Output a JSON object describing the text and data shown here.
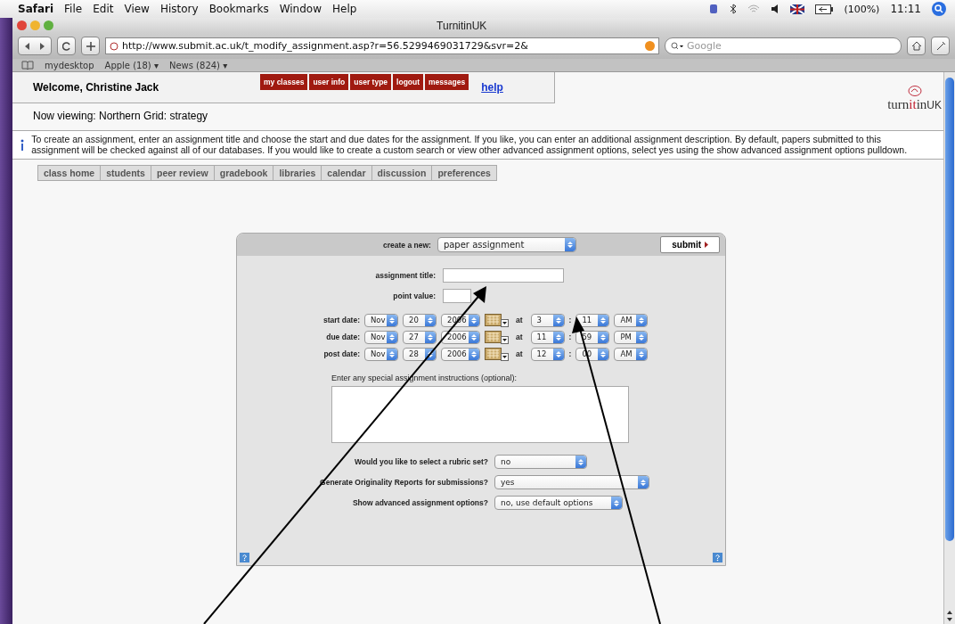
{
  "menubar": {
    "app": "Safari",
    "items": [
      "File",
      "Edit",
      "View",
      "History",
      "Bookmarks",
      "Window",
      "Help"
    ],
    "battery": "(100%)",
    "clock": "11:11"
  },
  "window": {
    "title": "TurnitinUK"
  },
  "toolbar": {
    "url": "http://www.submit.ac.uk/t_modify_assignment.asp?r=56.5299469031729&svr=2&",
    "search_placeholder": "Google"
  },
  "bookmarks": [
    "mydesktop",
    "Apple (18) ▾",
    "News (824) ▾"
  ],
  "header": {
    "welcome": "Welcome, Christine Jack",
    "nav": [
      "my classes",
      "user info",
      "user type",
      "logout",
      "messages"
    ],
    "help": "help",
    "viewing": "Now viewing: Northern Grid: strategy",
    "logo": {
      "main": "turn",
      "accent": "it",
      "rest": "in",
      "suffix": "UK"
    }
  },
  "info": "To create an assignment, enter an assignment title and choose the start and due dates for the assignment. If you like, you can enter an additional assignment description. By default, papers submitted to this assignment will be checked against all of our databases. If you would like to create a custom search or view other advanced assignment options, select yes using the show advanced assignment options pulldown.",
  "tabs": [
    "class home",
    "students",
    "peer review",
    "gradebook",
    "libraries",
    "calendar",
    "discussion",
    "preferences"
  ],
  "form": {
    "create_label": "create a new:",
    "create_value": "paper assignment",
    "submit": "submit",
    "title_label": "assignment title:",
    "points_label": "point value:",
    "dates": [
      {
        "label": "start date:",
        "month": "Nov",
        "day": "20",
        "year": "2006",
        "at": "at",
        "hour": "3",
        "sep": ":",
        "minute": "11",
        "ampm": "AM"
      },
      {
        "label": "due date:",
        "month": "Nov",
        "day": "27",
        "year": "2006",
        "at": "at",
        "hour": "11",
        "sep": ":",
        "minute": "59",
        "ampm": "PM"
      },
      {
        "label": "post date:",
        "month": "Nov",
        "day": "28",
        "year": "2006",
        "at": "at",
        "hour": "12",
        "sep": ":",
        "minute": "00",
        "ampm": "AM"
      }
    ],
    "instructions_label": "Enter any special assignment instructions (optional):",
    "questions": [
      {
        "label": "Would you like to select a rubric set?",
        "value": "no"
      },
      {
        "label": "Generate Originality Reports for submissions?",
        "value": "yes"
      },
      {
        "label": "Show advanced assignment options?",
        "value": "no, use default options"
      }
    ]
  }
}
